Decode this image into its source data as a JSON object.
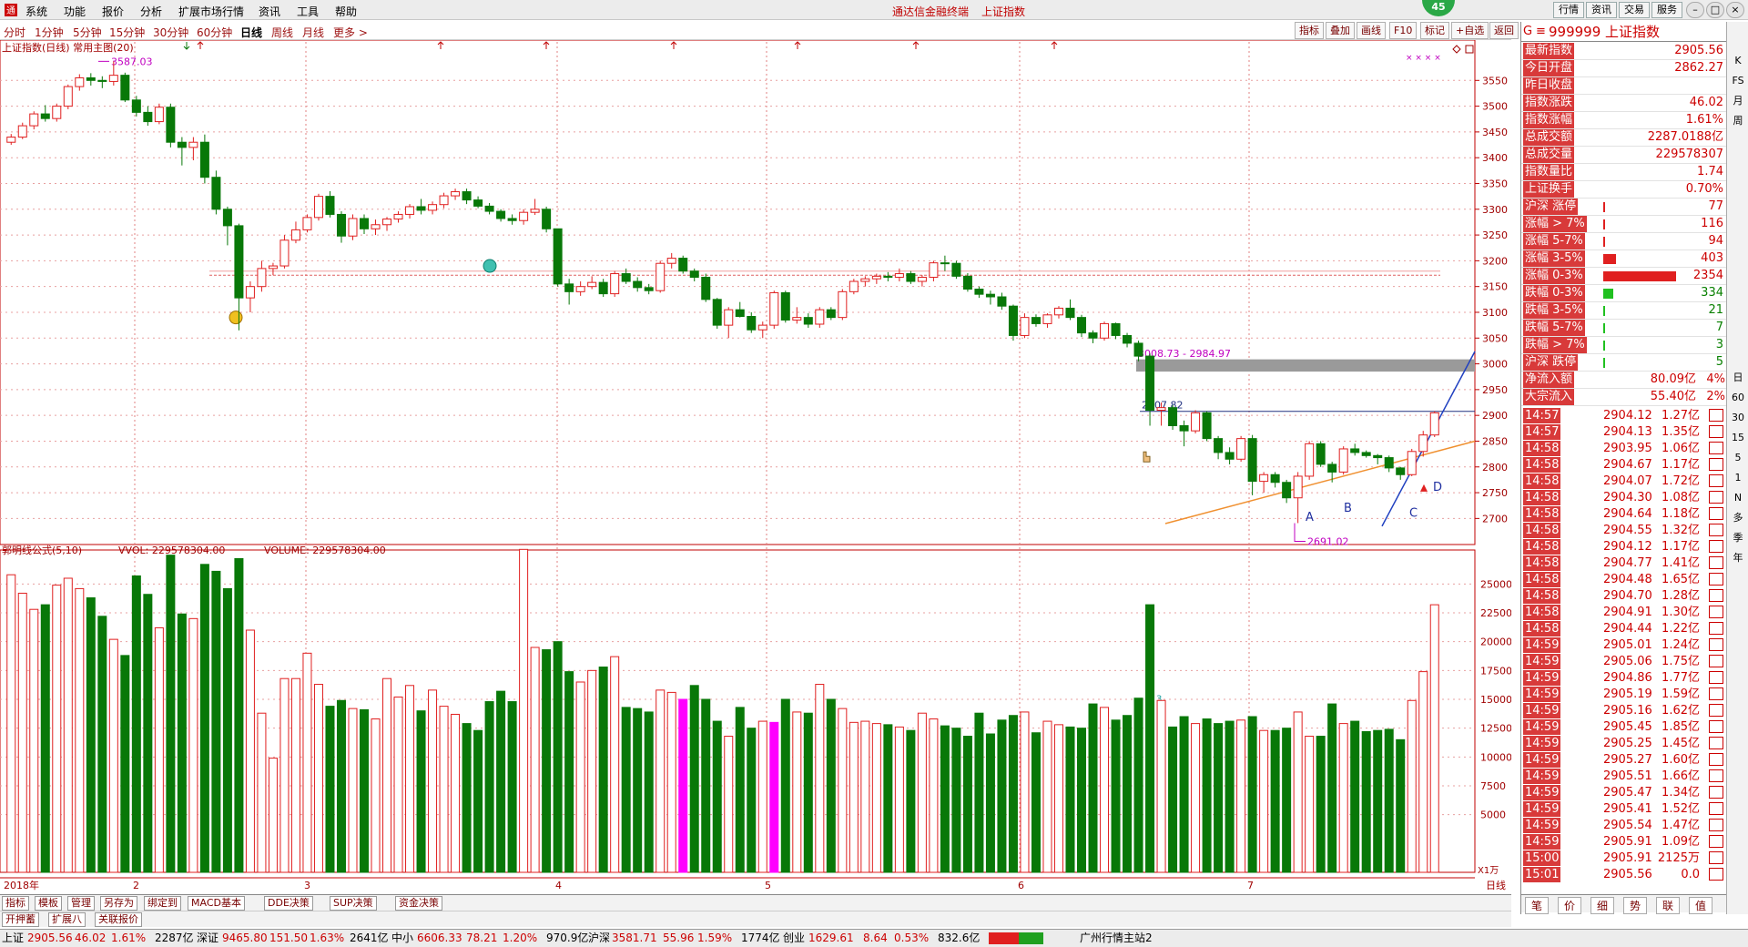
{
  "menubar": {
    "items": [
      "系统",
      "功能",
      "报价",
      "分析",
      "扩展市场行情",
      "资讯",
      "工具",
      "帮助"
    ],
    "app_title": "通达信金融终端",
    "window_title": "上证指数",
    "right_buttons": [
      "行情",
      "资讯",
      "交易",
      "服务"
    ],
    "badge": "45"
  },
  "periods": [
    "分时",
    "1分钟",
    "5分钟",
    "15分钟",
    "30分钟",
    "60分钟",
    "日线",
    "周线",
    "月线",
    "更多 >"
  ],
  "active_period": "日线",
  "chart_tools": [
    "指标",
    "叠加",
    "画线",
    "F10",
    "标记",
    "+自选",
    "返回"
  ],
  "chart": {
    "main_title": "上证指数(日线) 常用主图(20)",
    "price_axis": [
      3550,
      3500,
      3450,
      3400,
      3350,
      3300,
      3250,
      3200,
      3150,
      3100,
      3050,
      3000,
      2950,
      2900,
      2850,
      2800,
      2750,
      2700
    ],
    "max_label": "3587.03",
    "min_label": "2691.02",
    "gap_label": "3008.73 - 2984.97",
    "level_label": "2907.82",
    "pattern_labels": [
      "A",
      "B",
      "C",
      "D"
    ],
    "vol_title_1": "郭明线公式(5,10)",
    "vol_title_2": "VVOL: 229578304.00",
    "vol_title_3": "VOLUME: 229578304.00",
    "vol_axis": [
      25000,
      22500,
      20000,
      17500,
      15000,
      12500,
      10000,
      7500,
      5000
    ],
    "vol_unit": "X1万",
    "date_labels": [
      "2018年",
      "2",
      "3",
      "4",
      "5",
      "6",
      "7"
    ],
    "date_mode": "日线",
    "candles": [
      [
        3430,
        3446,
        3425,
        3440
      ],
      [
        3440,
        3468,
        3436,
        3462
      ],
      [
        3462,
        3490,
        3455,
        3485
      ],
      [
        3485,
        3502,
        3470,
        3476
      ],
      [
        3476,
        3505,
        3470,
        3500
      ],
      [
        3500,
        3542,
        3494,
        3538
      ],
      [
        3538,
        3562,
        3530,
        3555
      ],
      [
        3555,
        3564,
        3540,
        3550
      ],
      [
        3550,
        3558,
        3535,
        3548
      ],
      [
        3548,
        3587,
        3540,
        3560
      ],
      [
        3560,
        3565,
        3508,
        3512
      ],
      [
        3512,
        3520,
        3480,
        3488
      ],
      [
        3488,
        3500,
        3462,
        3470
      ],
      [
        3470,
        3505,
        3465,
        3498
      ],
      [
        3498,
        3505,
        3420,
        3430
      ],
      [
        3430,
        3440,
        3385,
        3420
      ],
      [
        3420,
        3440,
        3395,
        3430
      ],
      [
        3430,
        3445,
        3350,
        3362
      ],
      [
        3362,
        3375,
        3290,
        3300
      ],
      [
        3300,
        3305,
        3230,
        3268
      ],
      [
        3268,
        3272,
        3065,
        3128
      ],
      [
        3128,
        3160,
        3100,
        3150
      ],
      [
        3150,
        3200,
        3140,
        3185
      ],
      [
        3185,
        3196,
        3172,
        3190
      ],
      [
        3190,
        3250,
        3185,
        3240
      ],
      [
        3240,
        3276,
        3234,
        3260
      ],
      [
        3260,
        3290,
        3255,
        3284
      ],
      [
        3284,
        3330,
        3278,
        3325
      ],
      [
        3325,
        3335,
        3284,
        3290
      ],
      [
        3290,
        3296,
        3235,
        3248
      ],
      [
        3248,
        3290,
        3240,
        3282
      ],
      [
        3282,
        3290,
        3252,
        3262
      ],
      [
        3262,
        3280,
        3250,
        3270
      ],
      [
        3270,
        3285,
        3258,
        3281
      ],
      [
        3281,
        3296,
        3274,
        3290
      ],
      [
        3290,
        3310,
        3282,
        3305
      ],
      [
        3305,
        3320,
        3290,
        3298
      ],
      [
        3298,
        3315,
        3290,
        3309
      ],
      [
        3309,
        3332,
        3302,
        3326
      ],
      [
        3326,
        3340,
        3318,
        3334
      ],
      [
        3334,
        3340,
        3310,
        3318
      ],
      [
        3318,
        3325,
        3302,
        3306
      ],
      [
        3306,
        3312,
        3290,
        3296
      ],
      [
        3296,
        3300,
        3276,
        3282
      ],
      [
        3282,
        3290,
        3270,
        3278
      ],
      [
        3278,
        3300,
        3270,
        3294
      ],
      [
        3294,
        3320,
        3289,
        3300
      ],
      [
        3300,
        3305,
        3255,
        3262
      ],
      [
        3262,
        3225,
        3150,
        3155
      ],
      [
        3155,
        3165,
        3115,
        3140
      ],
      [
        3140,
        3160,
        3132,
        3150
      ],
      [
        3150,
        3170,
        3145,
        3158
      ],
      [
        3158,
        3165,
        3130,
        3136
      ],
      [
        3136,
        3180,
        3130,
        3175
      ],
      [
        3175,
        3185,
        3155,
        3160
      ],
      [
        3160,
        3168,
        3140,
        3148
      ],
      [
        3148,
        3155,
        3135,
        3142
      ],
      [
        3142,
        3200,
        3138,
        3195
      ],
      [
        3195,
        3215,
        3185,
        3205
      ],
      [
        3205,
        3210,
        3175,
        3180
      ],
      [
        3180,
        3185,
        3160,
        3168
      ],
      [
        3168,
        3175,
        3120,
        3125
      ],
      [
        3125,
        3128,
        3068,
        3075
      ],
      [
        3075,
        3110,
        3050,
        3105
      ],
      [
        3105,
        3120,
        3090,
        3092
      ],
      [
        3092,
        3100,
        3060,
        3066
      ],
      [
        3066,
        3082,
        3050,
        3075
      ],
      [
        3075,
        3142,
        3068,
        3138
      ],
      [
        3138,
        3142,
        3080,
        3085
      ],
      [
        3085,
        3110,
        3078,
        3090
      ],
      [
        3090,
        3098,
        3070,
        3077
      ],
      [
        3077,
        3110,
        3070,
        3105
      ],
      [
        3105,
        3110,
        3085,
        3090
      ],
      [
        3090,
        3145,
        3085,
        3140
      ],
      [
        3140,
        3165,
        3135,
        3160
      ],
      [
        3160,
        3170,
        3150,
        3165
      ],
      [
        3165,
        3175,
        3155,
        3170
      ],
      [
        3170,
        3178,
        3160,
        3168
      ],
      [
        3168,
        3185,
        3160,
        3175
      ],
      [
        3175,
        3180,
        3155,
        3160
      ],
      [
        3160,
        3172,
        3150,
        3168
      ],
      [
        3168,
        3200,
        3160,
        3196
      ],
      [
        3196,
        3210,
        3180,
        3195
      ],
      [
        3195,
        3200,
        3165,
        3170
      ],
      [
        3170,
        3176,
        3140,
        3145
      ],
      [
        3145,
        3150,
        3128,
        3135
      ],
      [
        3135,
        3142,
        3115,
        3130
      ],
      [
        3130,
        3138,
        3105,
        3112
      ],
      [
        3112,
        3115,
        3045,
        3055
      ],
      [
        3055,
        3098,
        3050,
        3090
      ],
      [
        3090,
        3096,
        3072,
        3078
      ],
      [
        3078,
        3098,
        3070,
        3095
      ],
      [
        3095,
        3112,
        3088,
        3108
      ],
      [
        3108,
        3125,
        3085,
        3090
      ],
      [
        3090,
        3095,
        3052,
        3060
      ],
      [
        3060,
        3065,
        3040,
        3050
      ],
      [
        3050,
        3082,
        3045,
        3078
      ],
      [
        3078,
        3080,
        3048,
        3055
      ],
      [
        3055,
        3060,
        3032,
        3040
      ],
      [
        3040,
        3045,
        3005,
        3015
      ],
      [
        3015,
        3020,
        2880,
        2910
      ],
      [
        2910,
        2925,
        2880,
        2915
      ],
      [
        2915,
        2920,
        2872,
        2880
      ],
      [
        2880,
        2890,
        2840,
        2870
      ],
      [
        2870,
        2910,
        2865,
        2905
      ],
      [
        2905,
        2908,
        2850,
        2855
      ],
      [
        2855,
        2860,
        2815,
        2828
      ],
      [
        2828,
        2838,
        2805,
        2815
      ],
      [
        2815,
        2860,
        2810,
        2855
      ],
      [
        2855,
        2862,
        2745,
        2772
      ],
      [
        2772,
        2790,
        2750,
        2785
      ],
      [
        2785,
        2790,
        2760,
        2770
      ],
      [
        2770,
        2775,
        2730,
        2740
      ],
      [
        2740,
        2790,
        2691,
        2782
      ],
      [
        2782,
        2850,
        2775,
        2845
      ],
      [
        2845,
        2850,
        2800,
        2805
      ],
      [
        2805,
        2810,
        2770,
        2790
      ],
      [
        2790,
        2840,
        2785,
        2835
      ],
      [
        2835,
        2845,
        2822,
        2828
      ],
      [
        2828,
        2832,
        2818,
        2822
      ],
      [
        2822,
        2825,
        2805,
        2818
      ],
      [
        2818,
        2822,
        2790,
        2798
      ],
      [
        2798,
        2800,
        2775,
        2785
      ],
      [
        2785,
        2835,
        2782,
        2830
      ],
      [
        2830,
        2870,
        2820,
        2862
      ],
      [
        2862,
        2908,
        2858,
        2905
      ]
    ],
    "volumes": [
      25800,
      24200,
      22800,
      23200,
      24900,
      25500,
      24600,
      23800,
      22200,
      20200,
      18800,
      25700,
      24100,
      21200,
      27500,
      22400,
      22000,
      26700,
      26100,
      24600,
      27200,
      21000,
      13800,
      9900,
      16800,
      16800,
      19000,
      16300,
      14400,
      14900,
      14200,
      14100,
      13300,
      16800,
      15200,
      16200,
      14000,
      15800,
      14400,
      13700,
      12900,
      12300,
      14800,
      15700,
      14800,
      28000,
      19500,
      19300,
      20000,
      17400,
      16500,
      17500,
      17800,
      18700,
      14300,
      14200,
      13900,
      15800,
      15600,
      15000,
      16200,
      15000,
      13100,
      11800,
      14300,
      12500,
      13100,
      13000,
      15000,
      13900,
      13800,
      16300,
      15000,
      14200,
      13000,
      13100,
      12900,
      12800,
      12600,
      12300,
      13800,
      13300,
      12700,
      12500,
      11800,
      13800,
      12000,
      13200,
      13600,
      13900,
      12100,
      13100,
      12800,
      12600,
      12500,
      14600,
      14300,
      13200,
      13600,
      15100,
      23200,
      14900,
      12600,
      13500,
      12900,
      13300,
      12900,
      13100,
      13200,
      13500,
      12300,
      12300,
      12500,
      13900,
      11800,
      11800,
      14600,
      12900,
      13100,
      12200,
      12300,
      12400,
      11500,
      14900,
      17400,
      23200
    ]
  },
  "quote": {
    "header": "999999 上证指数",
    "header_icon": "G",
    "rows": [
      {
        "label": "最新指数",
        "value": "2905.56"
      },
      {
        "label": "今日开盘",
        "value": "2862.27"
      },
      {
        "label": "昨日收盘",
        "value": ""
      },
      {
        "label": "指数涨跌",
        "value": "46.02"
      },
      {
        "label": "指数涨幅",
        "value": "1.61%"
      },
      {
        "label": "总成交额",
        "value": "2287.0188亿"
      },
      {
        "label": "总成交量",
        "value": "229578307"
      },
      {
        "label": "指数量比",
        "value": "1.74"
      },
      {
        "label": "上证换手",
        "value": "0.70%"
      }
    ],
    "breadth": [
      {
        "label": "沪深 涨停",
        "value": "77",
        "bar": 0.02,
        "color": "#e02020"
      },
      {
        "label": "涨幅 > 7%",
        "value": "116",
        "bar": 0.03,
        "color": "#e02020"
      },
      {
        "label": "涨幅 5-7%",
        "value": "94",
        "bar": 0.025,
        "color": "#e02020"
      },
      {
        "label": "涨幅 3-5%",
        "value": "403",
        "bar": 0.17,
        "color": "#e02020"
      },
      {
        "label": "涨幅 0-3%",
        "value": "2354",
        "bar": 1.0,
        "color": "#e02020"
      },
      {
        "label": "跌幅 0-3%",
        "value": "334",
        "bar": 0.14,
        "color": "#20c020"
      },
      {
        "label": "跌幅 3-5%",
        "value": "21",
        "bar": 0.01,
        "color": "#20c020"
      },
      {
        "label": "跌幅 5-7%",
        "value": "7",
        "bar": 0.005,
        "color": "#20c020"
      },
      {
        "label": "跌幅 > 7%",
        "value": "3",
        "bar": 0.005,
        "color": "#20c020"
      },
      {
        "label": "沪深 跌停",
        "value": "5",
        "bar": 0.005,
        "color": "#20c020"
      }
    ],
    "flows": [
      {
        "label": "净流入额",
        "value": "80.09亿",
        "pct": "4%"
      },
      {
        "label": "大宗流入",
        "value": "55.40亿",
        "pct": "2%"
      }
    ],
    "ticks": [
      [
        "14:57",
        "2904.12",
        "1.27亿"
      ],
      [
        "14:57",
        "2904.13",
        "1.35亿"
      ],
      [
        "14:58",
        "2903.95",
        "1.06亿"
      ],
      [
        "14:58",
        "2904.67",
        "1.17亿"
      ],
      [
        "14:58",
        "2904.07",
        "1.72亿"
      ],
      [
        "14:58",
        "2904.30",
        "1.08亿"
      ],
      [
        "14:58",
        "2904.64",
        "1.18亿"
      ],
      [
        "14:58",
        "2904.55",
        "1.32亿"
      ],
      [
        "14:58",
        "2904.12",
        "1.17亿"
      ],
      [
        "14:58",
        "2904.77",
        "1.41亿"
      ],
      [
        "14:58",
        "2904.48",
        "1.65亿"
      ],
      [
        "14:58",
        "2904.70",
        "1.28亿"
      ],
      [
        "14:58",
        "2904.91",
        "1.30亿"
      ],
      [
        "14:58",
        "2904.44",
        "1.22亿"
      ],
      [
        "14:59",
        "2905.01",
        "1.24亿"
      ],
      [
        "14:59",
        "2905.06",
        "1.75亿"
      ],
      [
        "14:59",
        "2904.86",
        "1.77亿"
      ],
      [
        "14:59",
        "2905.19",
        "1.59亿"
      ],
      [
        "14:59",
        "2905.16",
        "1.62亿"
      ],
      [
        "14:59",
        "2905.45",
        "1.85亿"
      ],
      [
        "14:59",
        "2905.25",
        "1.45亿"
      ],
      [
        "14:59",
        "2905.27",
        "1.60亿"
      ],
      [
        "14:59",
        "2905.51",
        "1.66亿"
      ],
      [
        "14:59",
        "2905.47",
        "1.34亿"
      ],
      [
        "14:59",
        "2905.41",
        "1.52亿"
      ],
      [
        "14:59",
        "2905.54",
        "1.47亿"
      ],
      [
        "14:59",
        "2905.91",
        "1.09亿"
      ],
      [
        "15:00",
        "2905.91",
        "2125万"
      ],
      [
        "15:01",
        "2905.56",
        "0.0"
      ]
    ],
    "bottom_tabs": [
      "笔",
      "价",
      "细",
      "势",
      "联",
      "值"
    ]
  },
  "side_strip": [
    "K",
    "FS",
    "月",
    "周",
    "日",
    "60",
    "30",
    "15",
    "5",
    "1",
    "N",
    "多",
    "季",
    "年"
  ],
  "tabs_row1": [
    "指标",
    "模板",
    "管理",
    "另存为",
    "绑定到",
    "MACD基本",
    "DDE决策",
    "SUP决策",
    "资金决策"
  ],
  "tabs_row2": [
    "开押蓄",
    "扩展八",
    "关联报价"
  ],
  "status": {
    "sh_label": "上证",
    "sh_value": "2905.56",
    "sh_chg": "46.02",
    "sh_pct": "1.61%",
    "sh_amt": "2287亿",
    "sz_label": "深证",
    "sz_value": "9465.80",
    "sz_chg": "151.50",
    "sz_pct": "1.63%",
    "sz_amt": "2641亿",
    "zx_label": "中小",
    "zx_value": "6606.33",
    "zx_chg": "78.21",
    "zx_pct": "1.20%",
    "zx_amt": "970.9亿",
    "hs_label": "沪深",
    "hs_value": "3581.71",
    "hs_chg": "55.96",
    "hs_pct": "1.59%",
    "hs_amt": "1774亿",
    "cy_label": "创业",
    "cy_value": "1629.61",
    "cy_chg": "8.64",
    "cy_pct": "0.53%",
    "cy_amt": "832.6亿",
    "server": "广州行情主站2"
  },
  "colors": {
    "up": "#e02020",
    "down": "#087808",
    "pink": "#ff00ff",
    "axis": "#c00000"
  }
}
